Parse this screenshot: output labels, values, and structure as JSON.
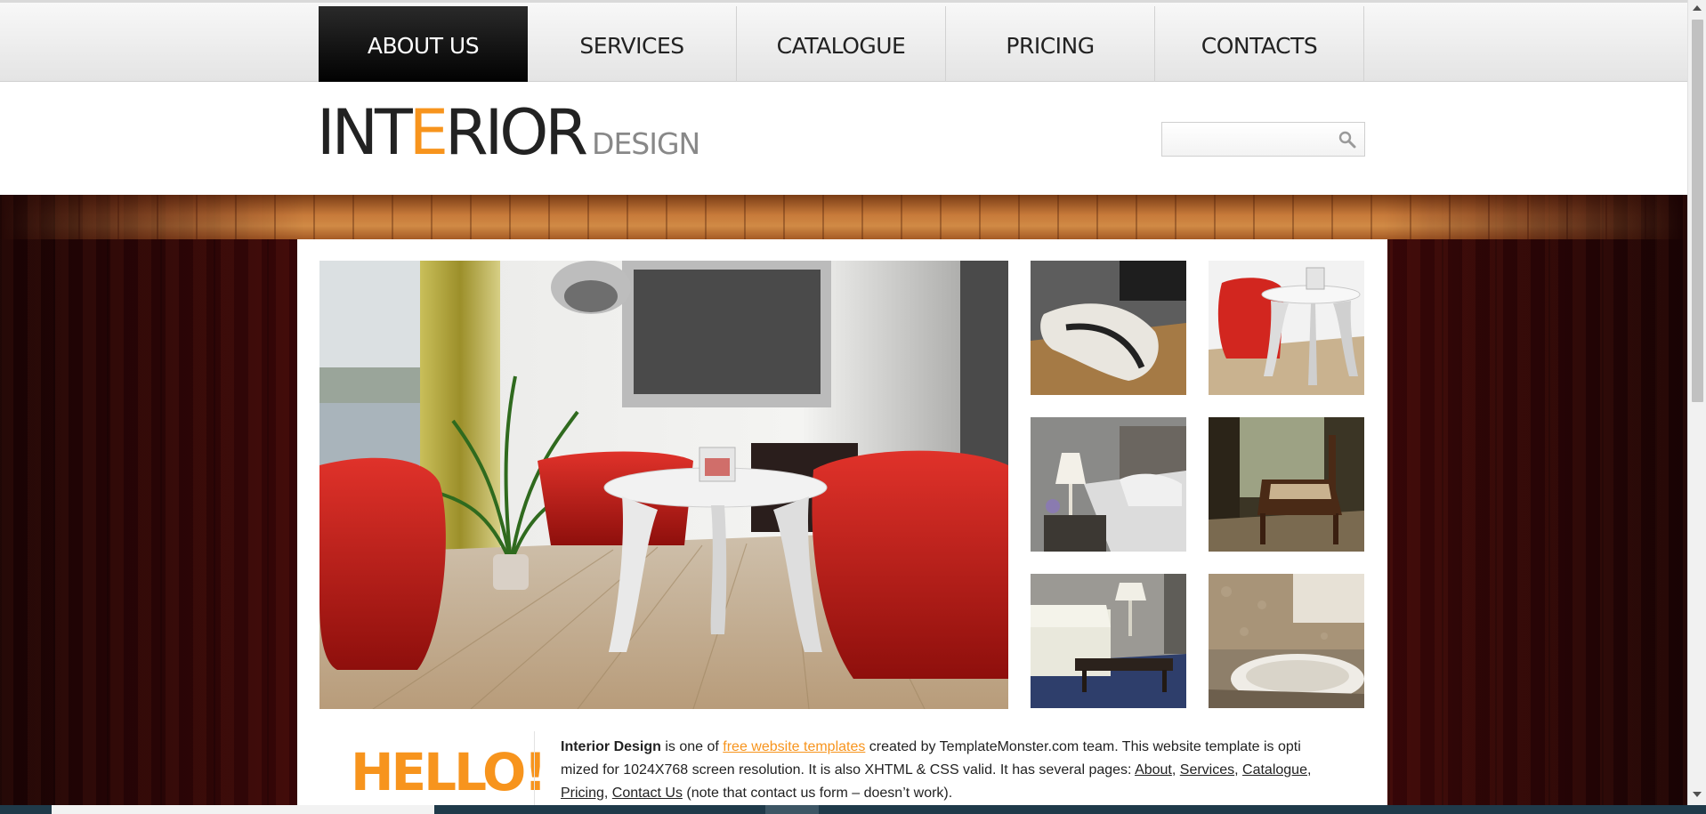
{
  "nav": {
    "items": [
      {
        "label": "ABOUT US",
        "active": true
      },
      {
        "label": "SERVICES",
        "active": false
      },
      {
        "label": "CATALOGUE",
        "active": false
      },
      {
        "label": "PRICING",
        "active": false
      },
      {
        "label": "CONTACTS",
        "active": false
      }
    ]
  },
  "logo": {
    "part1": "INT",
    "accent": "E",
    "part2": "RIOR",
    "sub": "DESIGN"
  },
  "search": {
    "value": "",
    "icon": "search-icon"
  },
  "gallery": {
    "hero": "living room with red chairs and white table",
    "thumbs": [
      "white lounge chair",
      "red chair with white table",
      "bedroom with lamp",
      "wooden armchair by window",
      "living room with coffee table",
      "bathroom with tub"
    ]
  },
  "intro": {
    "heading": "HELLO!",
    "brand": "Interior Design",
    "t1": " is one of ",
    "link_templates": "free website templates",
    "t2": " created by TemplateMonster.com team. This website template is opti mized for 1024X768 screen resolution. It is also XHTML & CSS valid. It has several pages: ",
    "link_about": "About",
    "sep1": ", ",
    "link_services": "Services",
    "sep2": ", ",
    "link_catalogue": "Catalogue",
    "sep3": ", ",
    "link_pricing": "Pricing",
    "sep4": ", ",
    "link_contact": "Contact Us",
    "t3": " (note that contact us form – doesn’t work)."
  },
  "colors": {
    "accent": "#f7941d",
    "wood": "#5a0e0c",
    "nav_active": "#000000"
  }
}
